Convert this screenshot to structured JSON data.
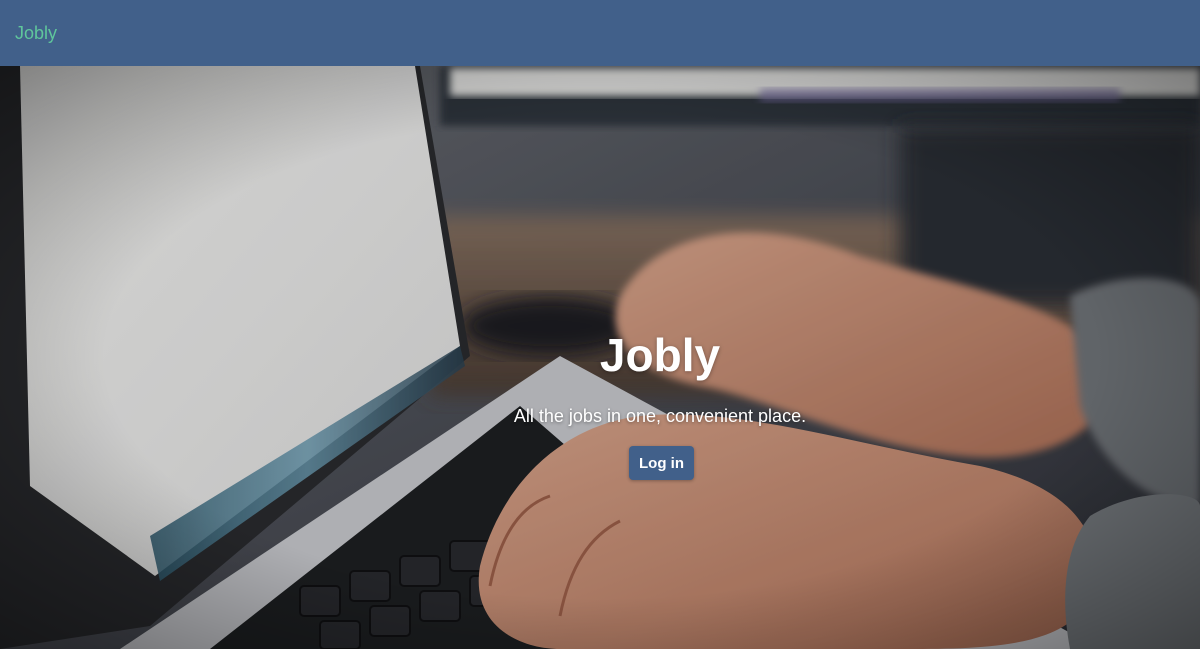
{
  "navbar": {
    "brand": "Jobly"
  },
  "hero": {
    "title": "Jobly",
    "subtitle": "All the jobs in one, convenient place.",
    "login_label": "Log in",
    "background": "photo-laptop-typing-hands"
  },
  "colors": {
    "navbar_bg": "#41608a",
    "brand_text": "#5fc69b",
    "button_bg": "#41608a",
    "hero_text": "#ffffff"
  }
}
